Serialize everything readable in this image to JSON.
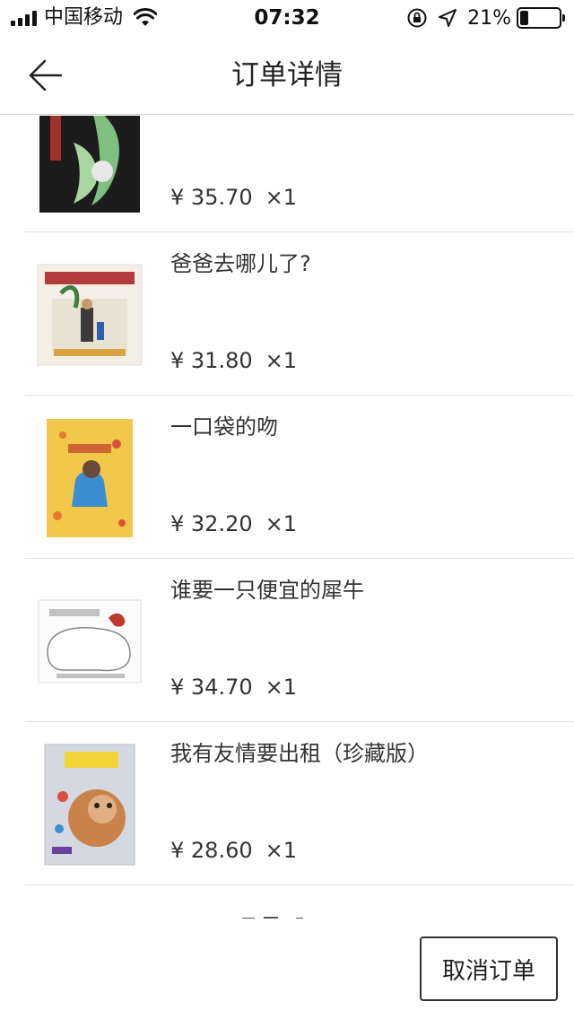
{
  "status_bar": {
    "carrier": "中国移动",
    "time": "07:32",
    "battery_text": "21%",
    "battery_level": 0.21,
    "icons": [
      "signal-icon",
      "wifi-icon",
      "rotation-lock-icon",
      "location-icon",
      "battery-icon"
    ]
  },
  "nav": {
    "title": "订单详情",
    "back_icon": "back-arrow-icon"
  },
  "order_items": [
    {
      "name": "",
      "price": "¥ 35.70",
      "qty": "×1"
    },
    {
      "name": "爸爸去哪儿了?",
      "price": "¥ 31.80",
      "qty": "×1"
    },
    {
      "name": "一口袋的吻",
      "price": "¥ 32.20",
      "qty": "×1"
    },
    {
      "name": "谁要一只便宜的犀牛",
      "price": "¥ 34.70",
      "qty": "×1"
    },
    {
      "name": "我有友情要出租（珍藏版）",
      "price": "¥ 28.60",
      "qty": "×1"
    }
  ],
  "footer": {
    "cancel_label": "取消订单"
  },
  "colors": {
    "text": "#222222",
    "divider": "#e3e3e3",
    "button_border": "#333333"
  }
}
